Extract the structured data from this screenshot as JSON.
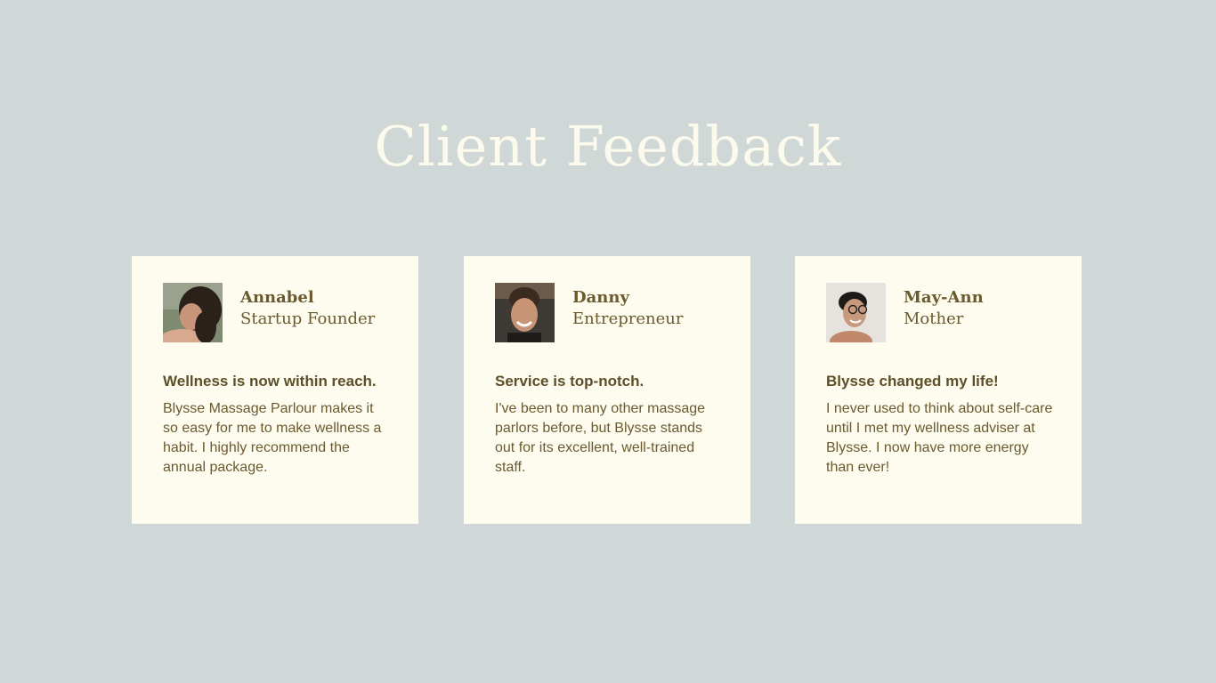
{
  "title": "Client Feedback",
  "colors": {
    "background": "#cfd8d7",
    "card": "#fdfcef",
    "title": "#fbfaed",
    "text": "#6b5a2f"
  },
  "testimonials": [
    {
      "name": "Annabel",
      "role": "Startup Founder",
      "headline": "Wellness is now within reach.",
      "quote": "Blysse Massage Parlour makes it so easy for me to make wellness a habit. I highly recommend the annual package.",
      "avatar": "woman-portrait-photo"
    },
    {
      "name": "Danny",
      "role": "Entrepreneur",
      "headline": "Service is top-notch.",
      "quote": "I've been to many other massage parlors before, but Blysse stands out for its excellent, well-trained staff.",
      "avatar": "woman-smiling-photo"
    },
    {
      "name": "May-Ann",
      "role": "Mother",
      "headline": "Blysse changed my life!",
      "quote": "I never used to think about self-care until I met my wellness adviser at Blysse. I now have more energy than ever!",
      "avatar": "woman-glasses-photo"
    }
  ]
}
